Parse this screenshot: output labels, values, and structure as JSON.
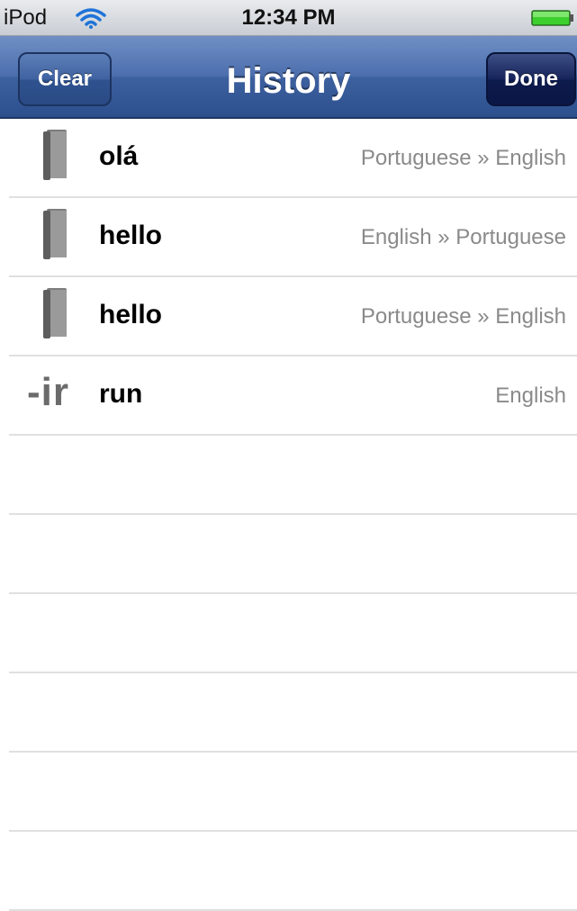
{
  "status_bar": {
    "device": "iPod",
    "time": "12:34 PM",
    "wifi_icon": "wifi-icon",
    "battery_icon": "battery-icon",
    "battery_color": "#3ccf2d"
  },
  "nav": {
    "title": "History",
    "clear_label": "Clear",
    "done_label": "Done"
  },
  "history": [
    {
      "icon": "book-icon",
      "word": "olá",
      "languages": "Portuguese » English"
    },
    {
      "icon": "book-icon",
      "word": "hello",
      "languages": "English » Portuguese"
    },
    {
      "icon": "book-icon",
      "word": "hello",
      "languages": "Portuguese » English"
    },
    {
      "icon": "conjugation-icon",
      "icon_text": "-ir",
      "word": "run",
      "languages": "English"
    }
  ]
}
